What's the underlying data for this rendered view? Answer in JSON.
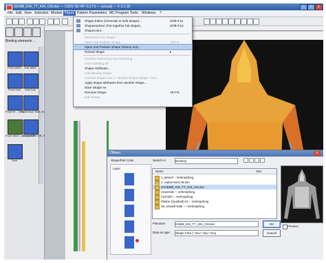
{
  "window": {
    "title": "3D/MB_KW_TT_404_CM.dsn — C3DV 3D-HP 3.3.TS — [visual] — V 3.1 20",
    "min_label": "–",
    "max_label": "□",
    "close_label": "x"
  },
  "menubar": {
    "items": [
      "File",
      "Edit",
      "View",
      "Selection",
      "Module",
      "Figure",
      "Pattern Parameters",
      "MC Program",
      "Tools",
      "Windows",
      "?"
    ],
    "active_index": 5
  },
  "left_panel": {
    "section_label": "Binding elements ...",
    "thumbs": [
      {
        "label": "Front stitch"
      },
      {
        "label": "rear stitch"
      },
      {
        "label": "Front tuck"
      },
      {
        "label": "rear tuck"
      },
      {
        "label": "Float for... Inlay"
      },
      {
        "label": "Float back float_b1"
      },
      {
        "label": "Front stitch... unified KR"
      },
      {
        "label": "rear_transfer KR_SFS"
      },
      {
        "label": "Tuck"
      }
    ]
  },
  "figure_menu": {
    "items": [
      {
        "label": "Shape Editor (Generate or Edit Shape)...",
        "shortcut": "Shift+F11",
        "disabled": false
      },
      {
        "label": "Shapeexplorer (Put together fab shape)...",
        "shortcut": "Shift+F12",
        "disabled": false
      },
      {
        "label": "ShapeColor...",
        "shortcut": "",
        "disabled": false
      },
      {
        "label": "Generate Free Shape",
        "shortcut": "",
        "disabled": true
      },
      {
        "label": "Open and Position Shape...",
        "shortcut": "Ctrl+O",
        "disabled": true
      },
      {
        "label": "Open and Position Shape (Stamp out)...",
        "shortcut": "",
        "disabled": false,
        "highlighted": true
      },
      {
        "label": "Reload Shape",
        "shortcut": "",
        "disabled": false,
        "submenu": true
      },
      {
        "label": "Insertion Narrowing and Widening",
        "shortcut": "",
        "disabled": true
      },
      {
        "label": "Insert Binding-off",
        "shortcut": "",
        "disabled": true
      },
      {
        "label": "Shape Attributes...",
        "shortcut": "",
        "disabled": false
      },
      {
        "label": "Add Missing Shape",
        "shortcut": "",
        "disabled": true
      },
      {
        "label": "Convert Shape (Ver.) + Stretch Shape Shape - Ver.)",
        "shortcut": "",
        "disabled": true
      },
      {
        "label": "Apply shape attributes from another shape...",
        "shortcut": "",
        "disabled": false
      },
      {
        "label": "Save Shape As",
        "shortcut": "",
        "disabled": false
      },
      {
        "label": "Remove Shape",
        "shortcut": "Alt+F8",
        "disabled": false
      },
      {
        "label": "Edit Shape",
        "shortcut": "",
        "disabled": true
      }
    ]
  },
  "open_dialog": {
    "title": "Öffnen",
    "left_header": "Shape/Part Color",
    "layer_label": "Layer",
    "search_in_label": "Search in:",
    "search_in_value": "Desktop",
    "column_name": "Name",
    "column_size": "Size",
    "files": [
      {
        "name": "1_aktuell – Verknüpfung",
        "selected": false
      },
      {
        "name": "2. replan-back-IB.dsn",
        "selected": false
      },
      {
        "name": "3AGBMB_KW_TT_404_CM.dsn",
        "selected": true
      },
      {
        "name": "Anwender – Verknüpfung",
        "selected": false
      },
      {
        "name": "Fachinfo – Verknüpfung",
        "selected": false
      },
      {
        "name": "Platine (Seatbelt) 01 – Verknüpfung",
        "selected": false
      },
      {
        "name": "Str_Modell.cbdk — Verknüpfung",
        "selected": false
      }
    ],
    "filename_label": "Filename:",
    "filename_value": "tr/3M9_KW_TT_404_CM.dsn",
    "filetype_label": "Data as type:",
    "filetype_value": "Shape Files (*.shx;*.shp;*.shx)",
    "ok_label": "OK",
    "cancel_label": "Cancel",
    "preview_label": "Preview"
  }
}
